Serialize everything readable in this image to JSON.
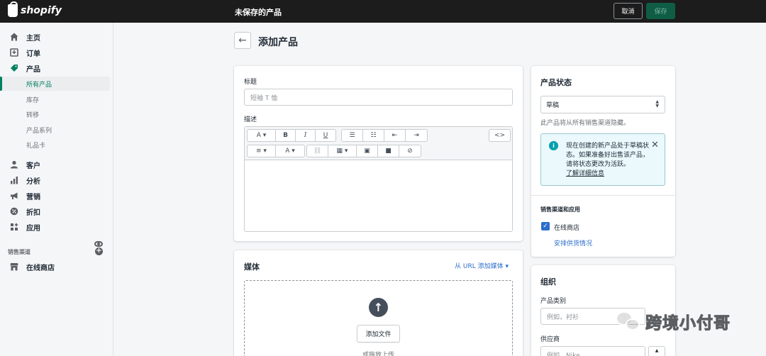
{
  "topbar": {
    "brand": "shopify",
    "title": "未保存的产品",
    "cancel_label": "取消",
    "save_label": "保存"
  },
  "sidebar": {
    "items": [
      {
        "label": "主页",
        "icon": "home-icon"
      },
      {
        "label": "订单",
        "icon": "orders-icon"
      },
      {
        "label": "产品",
        "icon": "tag-icon"
      },
      {
        "label": "客户",
        "icon": "person-icon"
      },
      {
        "label": "分析",
        "icon": "bar-chart-icon"
      },
      {
        "label": "营销",
        "icon": "megaphone-icon"
      },
      {
        "label": "折扣",
        "icon": "discount-icon"
      },
      {
        "label": "应用",
        "icon": "apps-icon"
      }
    ],
    "product_subitems": [
      "所有产品",
      "库存",
      "转移",
      "产品系列",
      "礼品卡"
    ],
    "channels_header": "销售渠道",
    "online_store": "在线商店"
  },
  "page": {
    "title": "添加产品"
  },
  "main_card": {
    "title_label": "标题",
    "title_placeholder": "短袖 T 恤",
    "description_label": "描述"
  },
  "media_card": {
    "title": "媒体",
    "add_from_url": "从 URL 添加媒体",
    "add_file": "添加文件",
    "drop_hint": "或拖放上传"
  },
  "status_card": {
    "title": "产品状态",
    "selected": "草稿",
    "hint": "此产品将从所有销售渠道隐藏。",
    "info_text": "现在创建的新产品处于草稿状态。如果准备好出售该产品，请将状态更改为活跃。",
    "info_link": "了解详细信息",
    "channels_title": "销售渠道和应用",
    "online_store": "在线商店",
    "schedule_link": "安排供货情况"
  },
  "org_card": {
    "title": "组织",
    "product_type_label": "产品类别",
    "product_type_placeholder": "例如，衬衫",
    "vendor_label": "供应商",
    "vendor_placeholder": "例如，Nike"
  },
  "watermark": "跨境小付哥",
  "colors": {
    "accent": "#008060",
    "link": "#2c6ecb",
    "topbar": "#1c1c1c"
  }
}
